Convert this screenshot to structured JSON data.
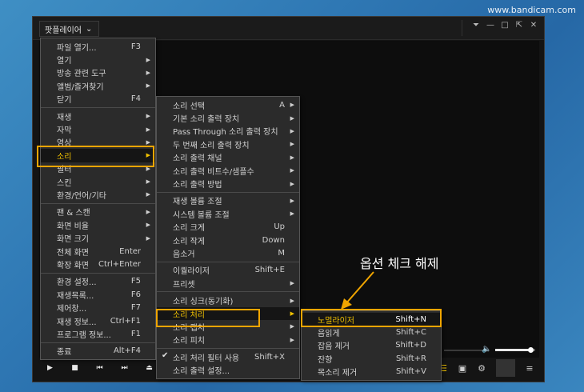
{
  "watermark": "www.bandicam.com",
  "app_title": "팟플레이어",
  "window_controls": [
    "pin-icon",
    "minimize-icon",
    "restore-icon",
    "fullscreen-icon",
    "close-icon"
  ],
  "main_menu": [
    {
      "label": "파일 열기...",
      "shortcut": "F3"
    },
    {
      "label": "열기",
      "arrow": true
    },
    {
      "label": "방송 관련 도구",
      "arrow": true
    },
    {
      "label": "앨범/즐겨찾기",
      "arrow": true
    },
    {
      "label": "닫기",
      "shortcut": "F4"
    },
    {
      "sep": true
    },
    {
      "label": "재생",
      "arrow": true
    },
    {
      "label": "자막",
      "arrow": true
    },
    {
      "label": "영상",
      "arrow": true
    },
    {
      "label": "소리",
      "arrow": true,
      "highlight": true
    },
    {
      "label": "필터",
      "arrow": true
    },
    {
      "label": "스킨",
      "arrow": true
    },
    {
      "label": "환경/언어/기타",
      "arrow": true
    },
    {
      "sep": true
    },
    {
      "label": "팬 & 스캔",
      "arrow": true
    },
    {
      "label": "화면 비율",
      "arrow": true
    },
    {
      "label": "화면 크기",
      "arrow": true
    },
    {
      "label": "전체 화면",
      "shortcut": "Enter"
    },
    {
      "label": "확장 화면",
      "shortcut": "Ctrl+Enter"
    },
    {
      "sep": true
    },
    {
      "label": "환경 설정...",
      "shortcut": "F5"
    },
    {
      "label": "재생목록...",
      "shortcut": "F6"
    },
    {
      "label": "제어창...",
      "shortcut": "F7"
    },
    {
      "label": "재생 정보...",
      "shortcut": "Ctrl+F1"
    },
    {
      "label": "프로그램 정보...",
      "shortcut": "F1"
    },
    {
      "sep": true
    },
    {
      "label": "종료",
      "shortcut": "Alt+F4"
    }
  ],
  "sound_menu": [
    {
      "label": "소리 선택",
      "shortcut": "A",
      "arrow": true
    },
    {
      "label": "기본 소리 출력 장치",
      "arrow": true
    },
    {
      "label": "Pass Through 소리 출력 장치",
      "arrow": true
    },
    {
      "label": "두 번째 소리 출력 장치",
      "arrow": true
    },
    {
      "label": "소리 출력 채널",
      "arrow": true
    },
    {
      "label": "소리 출력 비트수/샘플수",
      "arrow": true
    },
    {
      "label": "소리 출력 방법",
      "arrow": true
    },
    {
      "sep": true
    },
    {
      "label": "재생 볼륨 조절",
      "arrow": true
    },
    {
      "label": "시스템 볼륨 조절",
      "arrow": true
    },
    {
      "label": "소리 크게",
      "shortcut": "Up"
    },
    {
      "label": "소리 작게",
      "shortcut": "Down"
    },
    {
      "label": "음소거",
      "shortcut": "M"
    },
    {
      "sep": true
    },
    {
      "label": "이퀄라이저",
      "shortcut": "Shift+E"
    },
    {
      "label": "프리셋",
      "arrow": true
    },
    {
      "sep": true
    },
    {
      "label": "소리 싱크(동기화)",
      "arrow": true
    },
    {
      "label": "소리 처리",
      "arrow": true,
      "highlight": true
    },
    {
      "label": "소리 캡처",
      "arrow": true
    },
    {
      "label": "소리 피치",
      "arrow": true
    },
    {
      "sep": true
    },
    {
      "label": "소리 처리 필터 사용",
      "shortcut": "Shift+X",
      "checked": true
    },
    {
      "label": "소리 출력 설정..."
    }
  ],
  "process_menu": [
    {
      "label": "노멀라이저",
      "shortcut": "Shift+N",
      "highlight": true
    },
    {
      "label": "음읽게",
      "shortcut": "Shift+C"
    },
    {
      "label": "잡음 제거",
      "shortcut": "Shift+D"
    },
    {
      "label": "잔향",
      "shortcut": "Shift+R"
    },
    {
      "label": "목소리 제거",
      "shortcut": "Shift+V"
    }
  ],
  "annotation": "옵션 체크 해제",
  "volume_level": 0.9,
  "colors": {
    "highlight_text": "#f2c200",
    "callout_border": "#f0a500",
    "menu_bg": "#2b2b2b"
  }
}
